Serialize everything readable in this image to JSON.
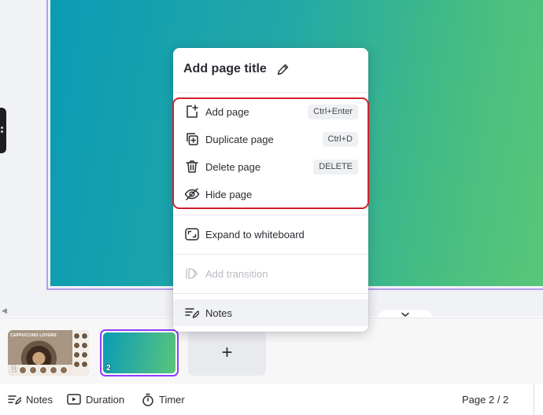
{
  "menu": {
    "title": "Add page title",
    "items": {
      "add_page": {
        "label": "Add page",
        "shortcut": "Ctrl+Enter"
      },
      "duplicate_page": {
        "label": "Duplicate page",
        "shortcut": "Ctrl+D"
      },
      "delete_page": {
        "label": "Delete page",
        "shortcut": "DELETE"
      },
      "hide_page": {
        "label": "Hide page"
      },
      "expand_whiteboard": {
        "label": "Expand to whiteboard"
      },
      "add_transition": {
        "label": "Add transition",
        "disabled": true
      },
      "notes": {
        "label": "Notes"
      }
    }
  },
  "filmstrip": {
    "pages": [
      {
        "number": "1",
        "caption": "CAPPUCCINO LOVERS"
      },
      {
        "number": "2",
        "selected": true
      }
    ],
    "add_page_symbol": "+"
  },
  "bottombar": {
    "notes": "Notes",
    "duration": "Duration",
    "timer": "Timer",
    "page_counter": "Page 2 / 2"
  },
  "colors": {
    "accent": "#8b3dff",
    "highlight_border": "#d21f2e",
    "gradient_start": "#0a9bb4",
    "gradient_end": "#5ac679"
  },
  "icons": [
    "edit-pencil-icon",
    "add-page-icon",
    "duplicate-page-icon",
    "trash-icon",
    "eye-off-icon",
    "whiteboard-expand-icon",
    "transition-icon",
    "notes-icon",
    "duration-icon",
    "timer-icon",
    "chevron-down-icon"
  ]
}
